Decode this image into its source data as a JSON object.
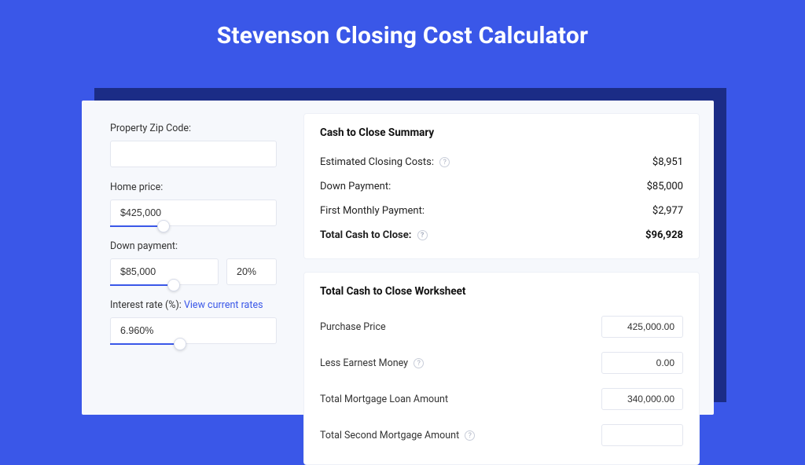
{
  "page": {
    "title": "Stevenson Closing Cost Calculator"
  },
  "left": {
    "zip_label": "Property Zip Code:",
    "zip_value": "",
    "home_price_label": "Home price:",
    "home_price_value": "$425,000",
    "home_price_slider_pct": 32,
    "down_payment_label": "Down payment:",
    "down_payment_value": "$85,000",
    "down_payment_pct_value": "20%",
    "down_payment_slider_pct": 38,
    "interest_label_prefix": "Interest rate (%): ",
    "interest_link_text": "View current rates",
    "interest_value": "6.960%",
    "interest_slider_pct": 42
  },
  "summary": {
    "heading": "Cash to Close Summary",
    "rows": [
      {
        "label": "Estimated Closing Costs:",
        "help": true,
        "value": "$8,951",
        "bold": false
      },
      {
        "label": "Down Payment:",
        "help": false,
        "value": "$85,000",
        "bold": false
      },
      {
        "label": "First Monthly Payment:",
        "help": false,
        "value": "$2,977",
        "bold": false
      },
      {
        "label": "Total Cash to Close:",
        "help": true,
        "value": "$96,928",
        "bold": true
      }
    ]
  },
  "worksheet": {
    "heading": "Total Cash to Close Worksheet",
    "rows": [
      {
        "label": "Purchase Price",
        "help": false,
        "value": "425,000.00"
      },
      {
        "label": "Less Earnest Money",
        "help": true,
        "value": "0.00"
      },
      {
        "label": "Total Mortgage Loan Amount",
        "help": false,
        "value": "340,000.00"
      },
      {
        "label": "Total Second Mortgage Amount",
        "help": true,
        "value": ""
      }
    ]
  },
  "icons": {
    "help_glyph": "?"
  }
}
